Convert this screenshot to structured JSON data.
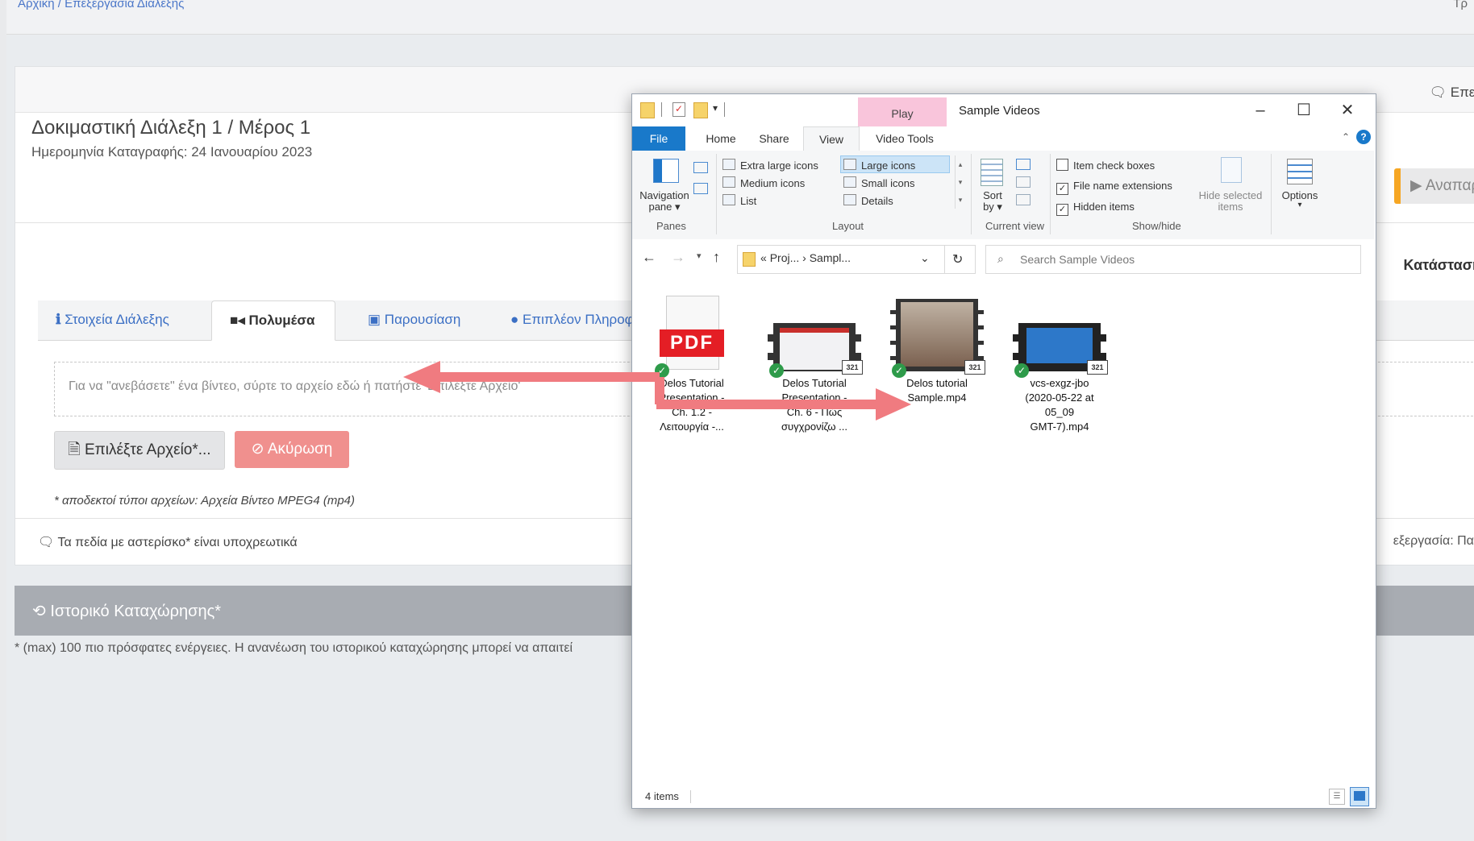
{
  "topbar": {
    "breadcrumb": "Αρχική / Επεξεργασία Διάλεξης",
    "right_text": "Τρ"
  },
  "card": {
    "comments_label": "Επεξ",
    "lecture_title": "Δοκιμαστική Διάλεξη 1 / Μέρος 1",
    "recording_date": "Ημερομηνία Καταγραφής: 24 Ιανουαρίου 2023",
    "play_label": "Αναπαρ",
    "status_label": "Κατάσταση",
    "tabs": [
      "Στοιχεία Διάλεξης",
      "Πολυμέσα",
      "Παρουσίαση",
      "Επιπλέον Πληροφο"
    ],
    "drop_text": "Για να \"ανεβάσετε\" ένα βίντεο, σύρτε το αρχείο εδώ ή πατήστε 'Επιλέξτε Αρχείο'",
    "choose_button": "Επιλέξτε Αρχείο*...",
    "cancel_button": "Ακύρωση",
    "file_types": "* αποδεκτοί τύποι αρχείων: Αρχεία Βίντεο MPEG4 (mp4)",
    "required_note": "Τα πεδία με αστερίσκο* είναι υποχρεωτικά",
    "processing": "εξεργασία: Παρ"
  },
  "history": {
    "title": "Ιστορικό Καταχώρησης*",
    "note": "* (max) 100 πιο πρόσφατες ενέργειες. Η ανανέωση του ιστορικού καταχώρησης μπορεί να απαιτεί"
  },
  "explorer": {
    "context_tab": "Play",
    "window_title": "Sample Videos",
    "ribbon_tabs": [
      "File",
      "Home",
      "Share",
      "View",
      "Video Tools"
    ],
    "panes": {
      "navigation_pane": "Navigation",
      "navigation_pane2": "pane ▾",
      "group": "Panes"
    },
    "layout": {
      "items": [
        "Extra large icons",
        "Large icons",
        "Medium icons",
        "Small icons",
        "List",
        "Details"
      ],
      "selected": "Large icons",
      "group": "Layout"
    },
    "current_view": {
      "sort": "Sort",
      "sort2": "by ▾",
      "group": "Current view"
    },
    "show_hide": {
      "item_check_boxes": "Item check boxes",
      "file_name_extensions": "File name extensions",
      "hidden_items": "Hidden items",
      "hide_selected": "Hide selected",
      "hide_selected2": "items",
      "group": "Show/hide"
    },
    "options": "Options",
    "address": {
      "prefix": "«",
      "part1": "Proj...",
      "part2": "Sampl..."
    },
    "search_placeholder": "Search Sample Videos",
    "files": [
      {
        "name1": "Delos Tutorial",
        "name2": "Presentation -",
        "name3": "Ch. 1.2 -",
        "name4": "Λειτουργία -..."
      },
      {
        "name1": "Delos Tutorial",
        "name2": "Presentation -",
        "name3": "Ch. 6 - Πώς",
        "name4": "συγχρονίζω ..."
      },
      {
        "name1": "Delos tutorial",
        "name2": "Sample.mp4",
        "name3": "",
        "name4": ""
      },
      {
        "name1": "vcs-exgz-jbo",
        "name2": "(2020-05-22 at",
        "name3": "05_09",
        "name4": "GMT-7).mp4"
      }
    ],
    "status": "4 items",
    "pdf_label": "PDF"
  },
  "colors": {
    "accent": "#1979ca",
    "arrow": "#f07b80",
    "cancel": "#f0908e",
    "orange": "#f6a623",
    "play_ctx": "#f9c5db"
  }
}
